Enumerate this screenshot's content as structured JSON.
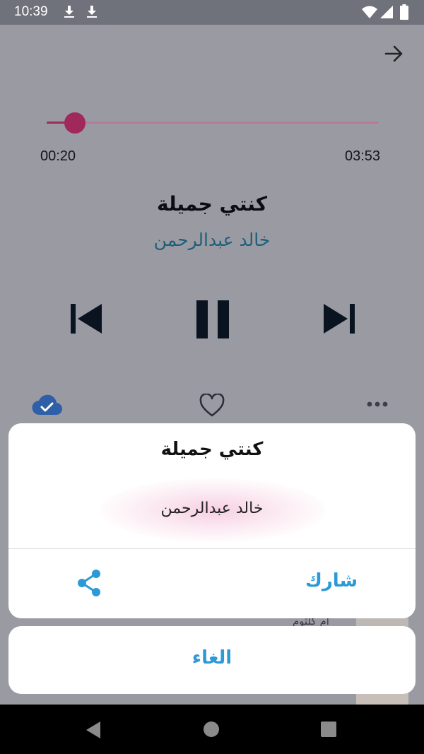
{
  "status_bar": {
    "time": "10:39",
    "icons": [
      "download-icon",
      "download-icon",
      "wifi-icon",
      "signal-icon",
      "battery-icon"
    ]
  },
  "player": {
    "progress": {
      "current": "00:20",
      "total": "03:53",
      "fraction": 0.086
    },
    "song": {
      "title": "كنتي جميلة",
      "artist": "خالد عبدالرحمن"
    },
    "controls": [
      "previous-icon",
      "pause-icon",
      "next-icon"
    ],
    "actions": [
      "cloud-check-icon",
      "heart-icon",
      "more-icon"
    ]
  },
  "background_list": {
    "item_text": "أم كلثوم"
  },
  "action_sheet": {
    "title": "كنتي جميلة",
    "subtitle": "خالد عبدالرحمن",
    "share_label": "شارك",
    "cancel_label": "الغاء"
  },
  "colors": {
    "accent": "#2c9ad6",
    "seek": "#a0285a",
    "artist": "#1d5e79"
  }
}
